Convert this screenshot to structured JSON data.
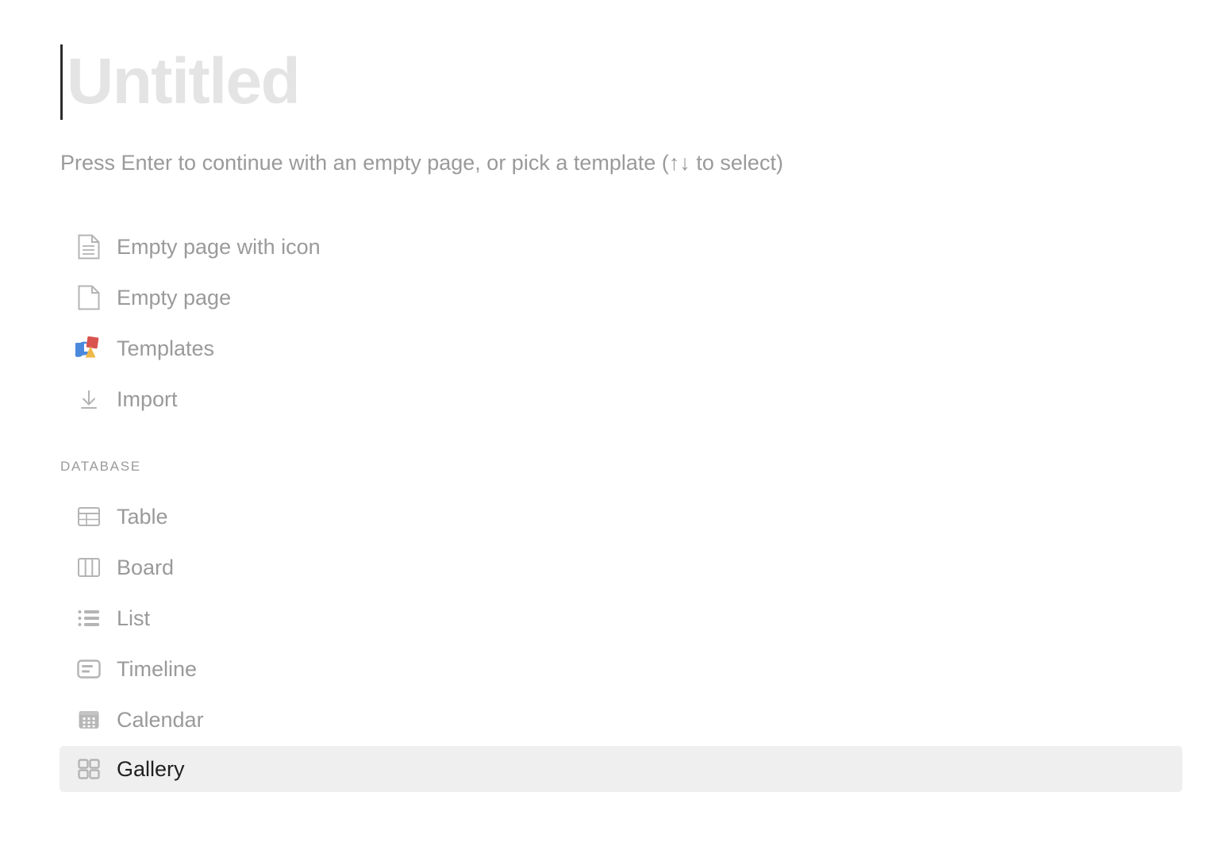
{
  "page": {
    "title_placeholder": "Untitled",
    "hint": "Press Enter to continue with an empty page, or pick a template (↑↓ to select)",
    "background_color": "#ffffff",
    "placeholder_color": "#e4e4e4",
    "muted_text_color": "#9a9a9a",
    "selected_text_color": "#202020",
    "selected_row_color": "#efefef",
    "caret_color": "#2c2c2c"
  },
  "quick_options": [
    {
      "label": "Empty page with icon",
      "icon": "page-with-lines-icon",
      "selected": false
    },
    {
      "label": "Empty page",
      "icon": "page-icon",
      "selected": false
    },
    {
      "label": "Templates",
      "icon": "templates-icon",
      "selected": false
    },
    {
      "label": "Import",
      "icon": "import-icon",
      "selected": false
    }
  ],
  "database_section": {
    "header": "DATABASE",
    "options": [
      {
        "label": "Table",
        "icon": "table-icon",
        "selected": false
      },
      {
        "label": "Board",
        "icon": "board-icon",
        "selected": false
      },
      {
        "label": "List",
        "icon": "list-icon",
        "selected": false
      },
      {
        "label": "Timeline",
        "icon": "timeline-icon",
        "selected": false
      },
      {
        "label": "Calendar",
        "icon": "calendar-icon",
        "selected": false
      },
      {
        "label": "Gallery",
        "icon": "gallery-icon",
        "selected": true
      }
    ]
  },
  "templates_icon_colors": {
    "circle": "#4a89dc",
    "square": "#d9534f",
    "triangle": "#f0b849"
  }
}
